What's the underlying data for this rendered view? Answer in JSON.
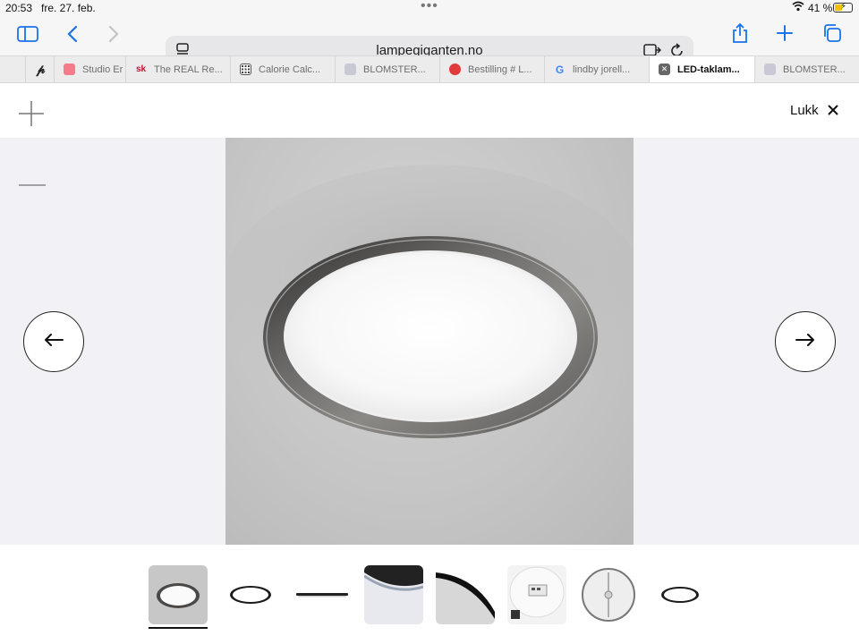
{
  "status_bar": {
    "time": "20:53",
    "date": "fre. 27. feb.",
    "battery": "41 %"
  },
  "browser": {
    "url": "lampegiganten.no",
    "tabs": [
      {
        "label": "",
        "favicon": "pinterest",
        "color": "#222222"
      },
      {
        "label": "Studio Er",
        "favicon": "studio",
        "color": "#f47a8c"
      },
      {
        "label": "The REAL Re...",
        "favicon": "sk",
        "color": "#c8102e"
      },
      {
        "label": "Calorie Calc...",
        "favicon": "calculator",
        "color": "#444444"
      },
      {
        "label": "BLOMSTER...",
        "favicon": "generic",
        "color": "#c9c9d6"
      },
      {
        "label": "Bestilling # L...",
        "favicon": "red-circle",
        "color": "#e03a3a"
      },
      {
        "label": "lindby jorell...",
        "favicon": "google",
        "color": "#4285f4"
      },
      {
        "label": "LED-taklam...",
        "favicon": "close-box",
        "color": "#555555",
        "active": true
      },
      {
        "label": "BLOMSTER...",
        "favicon": "generic",
        "color": "#c9c9d6"
      }
    ]
  },
  "viewer": {
    "close_label": "Lukk",
    "zoom_in": "+",
    "zoom_out": "—"
  },
  "thumbnails": [
    {
      "name": "ceiling-photo",
      "selected": true
    },
    {
      "name": "top-view-black-ring"
    },
    {
      "name": "side-profile"
    },
    {
      "name": "edge-closeup"
    },
    {
      "name": "angled-rim-closeup"
    },
    {
      "name": "back-with-driver"
    },
    {
      "name": "back-plate-white"
    },
    {
      "name": "small-top-view"
    }
  ]
}
